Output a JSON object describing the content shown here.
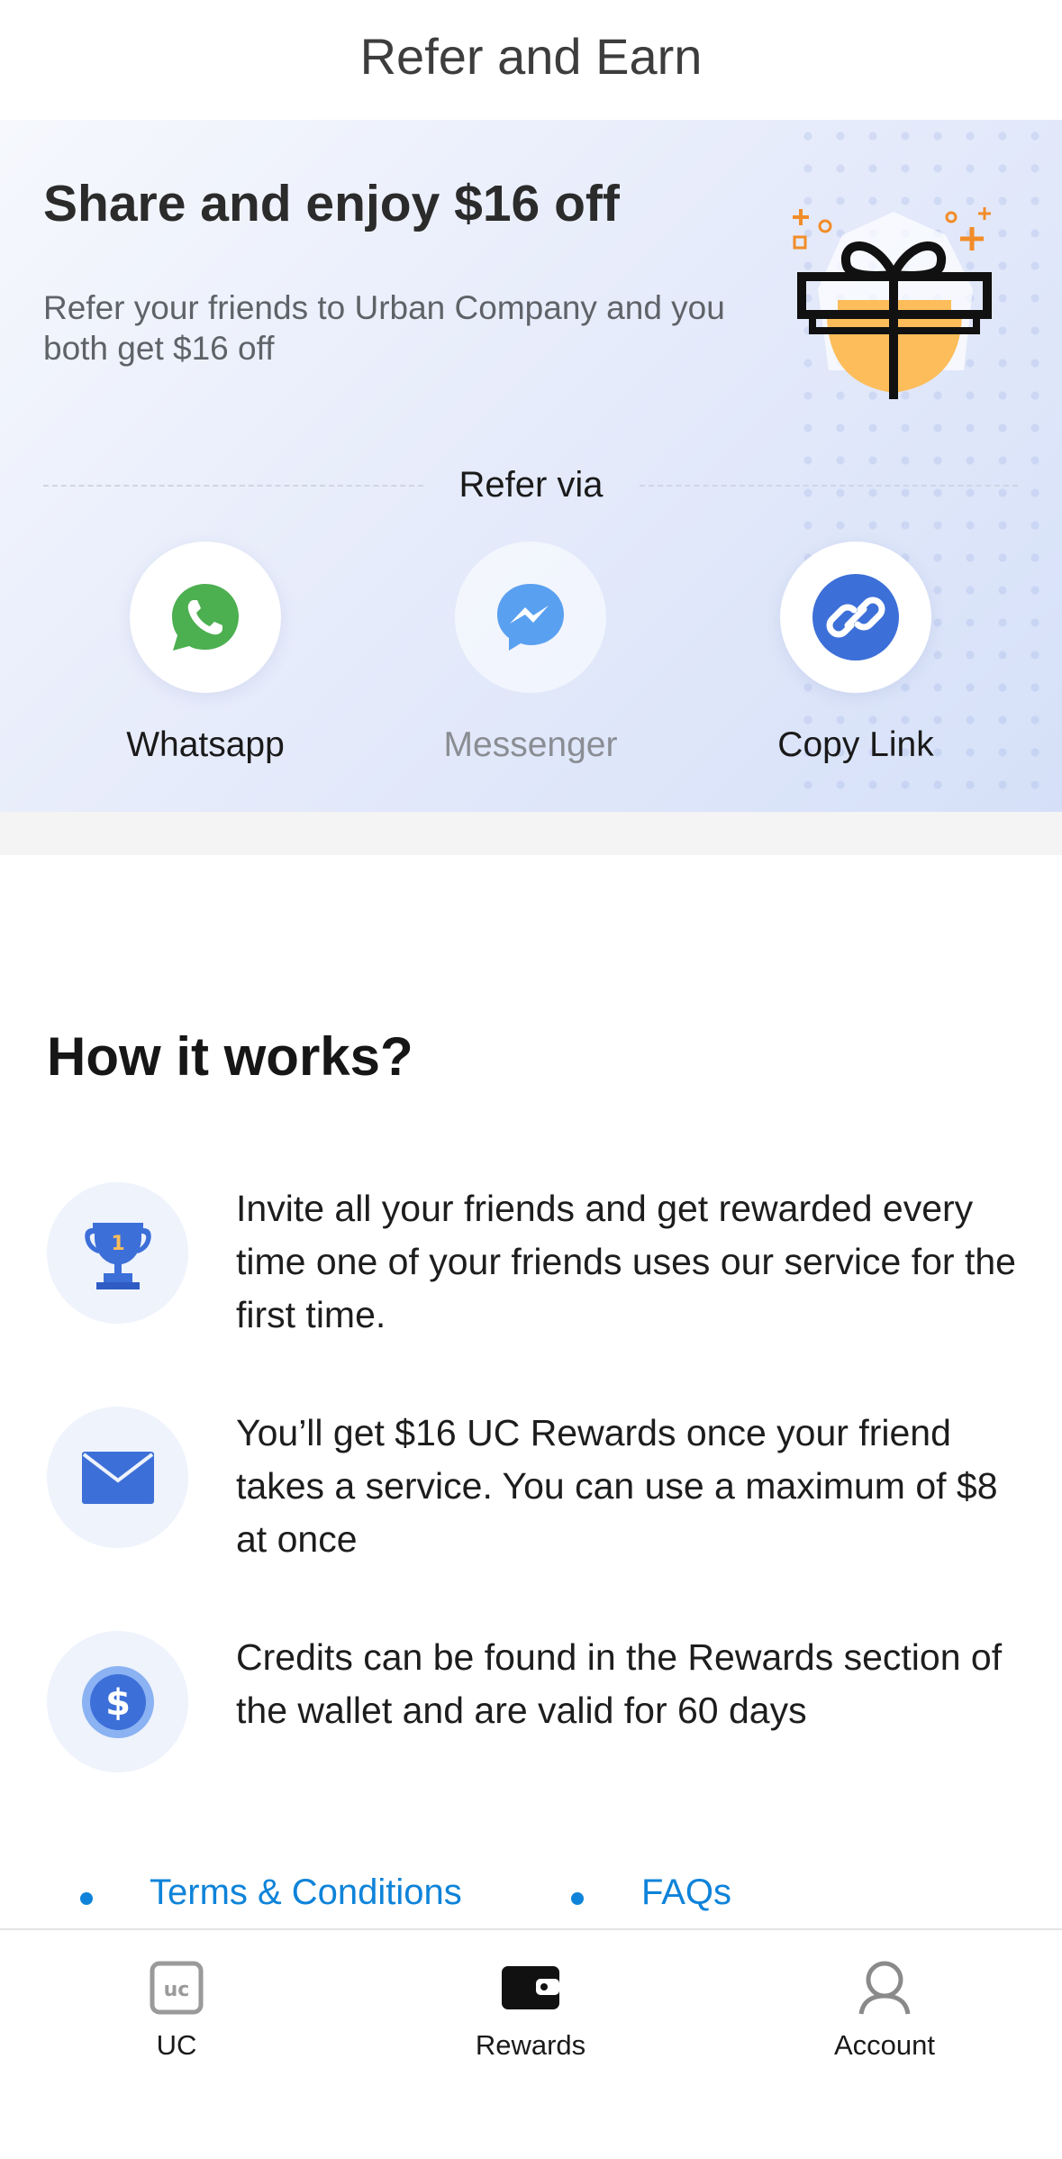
{
  "header": {
    "title": "Refer and Earn"
  },
  "hero": {
    "title": "Share and enjoy $16 off",
    "subtitle": "Refer your friends to Urban Company and you both get $16 off",
    "refer_via": "Refer via",
    "share_options": [
      {
        "label": "Whatsapp",
        "icon": "whatsapp-icon",
        "color": "#4caf50"
      },
      {
        "label": "Messenger",
        "icon": "messenger-icon",
        "color": "#5aa0f0"
      },
      {
        "label": "Copy Link",
        "icon": "link-icon",
        "color": "#3d6fd8"
      }
    ]
  },
  "how_it_works": {
    "title": "How it works?",
    "steps": [
      {
        "icon": "trophy-icon",
        "text": "Invite all your friends and get rewarded every time one of your friends uses our service for the first time."
      },
      {
        "icon": "envelope-icon",
        "text": "You’ll get $16 UC Rewards once your friend takes a service. You can use a maximum of $8 at once"
      },
      {
        "icon": "dollar-coin-icon",
        "text": "Credits can be found in the Rewards section of the wallet and are valid for 60 days"
      }
    ]
  },
  "links": {
    "terms": "Terms & Conditions",
    "faqs": "FAQs"
  },
  "tabbar": {
    "tabs": [
      {
        "label": "UC",
        "icon": "uc-logo-icon"
      },
      {
        "label": "Rewards",
        "icon": "wallet-icon"
      },
      {
        "label": "Account",
        "icon": "user-icon"
      }
    ]
  },
  "colors": {
    "accent": "#3d6fd8",
    "link": "#0e83d9",
    "gift": "#fcbd5a"
  }
}
